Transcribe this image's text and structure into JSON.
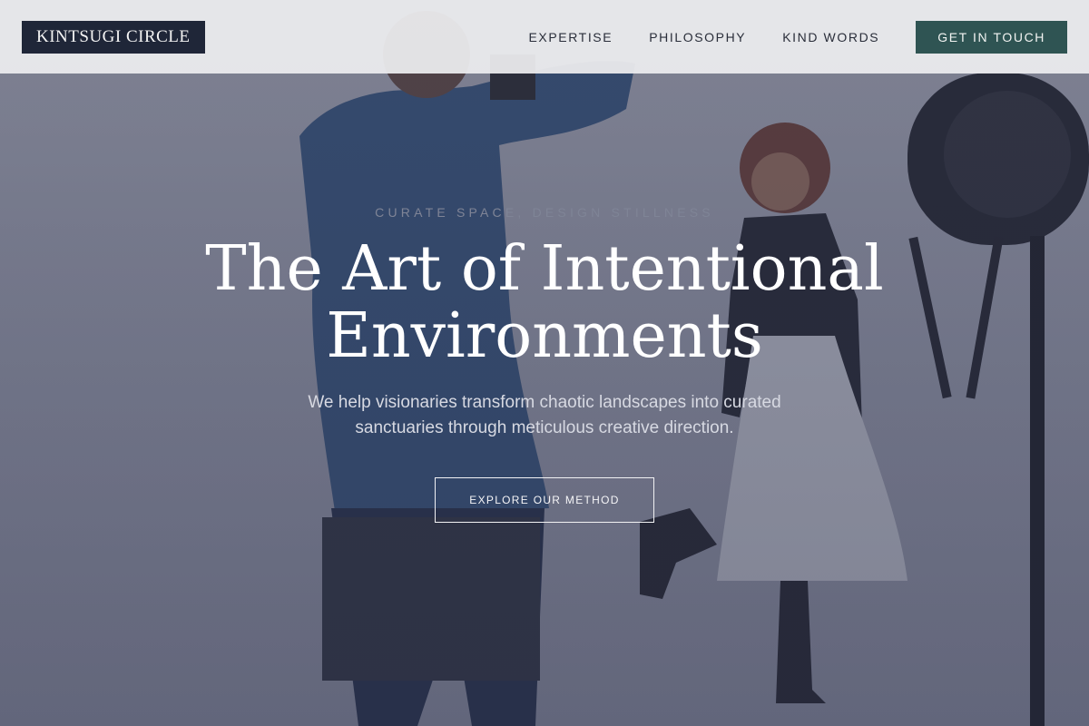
{
  "nav": {
    "logo": "KINTSUGI CIRCLE",
    "links": [
      {
        "label": "EXPERTISE"
      },
      {
        "label": "PHILOSOPHY"
      },
      {
        "label": "KIND WORDS"
      }
    ],
    "cta_label": "GET IN TOUCH"
  },
  "hero": {
    "eyebrow": "CURATE SPACE, DESIGN STILLNESS",
    "headline": "The Art of Intentional Environments",
    "subtext": "We help visionaries transform chaotic landscapes into curated sanctuaries through meticulous creative direction.",
    "button_label": "EXPLORE OUR METHOD"
  },
  "colors": {
    "logo_bg": "#1f2638",
    "cta_bg": "#2f5453",
    "overlay": "#363a54"
  }
}
